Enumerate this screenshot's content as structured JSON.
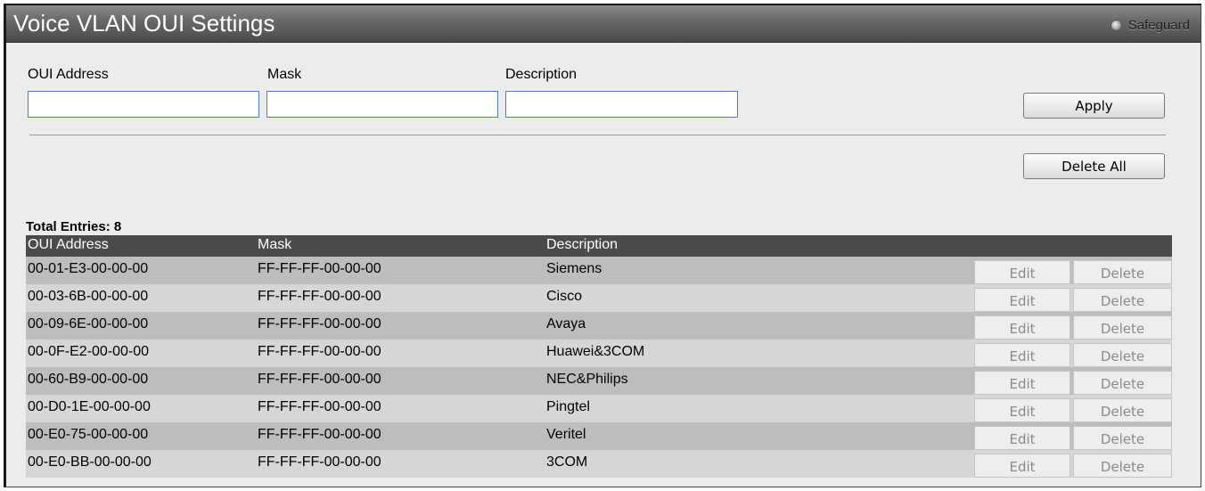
{
  "window": {
    "title": "Voice VLAN OUI Settings",
    "safeguard_label": "Safeguard"
  },
  "form": {
    "oui_label": "OUI Address",
    "mask_label": "Mask",
    "description_label": "Description",
    "oui_value": "",
    "mask_value": "",
    "description_value": "",
    "apply_label": "Apply",
    "delete_all_label": "Delete All"
  },
  "table": {
    "total_entries": "Total Entries: 8",
    "headers": [
      "OUI Address",
      "Mask",
      "Description"
    ],
    "edit_label": "Edit",
    "delete_label": "Delete",
    "rows": [
      {
        "oui": "00-01-E3-00-00-00",
        "mask": "FF-FF-FF-00-00-00",
        "description": "Siemens"
      },
      {
        "oui": "00-03-6B-00-00-00",
        "mask": "FF-FF-FF-00-00-00",
        "description": "Cisco"
      },
      {
        "oui": "00-09-6E-00-00-00",
        "mask": "FF-FF-FF-00-00-00",
        "description": "Avaya"
      },
      {
        "oui": "00-0F-E2-00-00-00",
        "mask": "FF-FF-FF-00-00-00",
        "description": "Huawei&3COM"
      },
      {
        "oui": "00-60-B9-00-00-00",
        "mask": "FF-FF-FF-00-00-00",
        "description": "NEC&Philips"
      },
      {
        "oui": "00-D0-1E-00-00-00",
        "mask": "FF-FF-FF-00-00-00",
        "description": "Pingtel"
      },
      {
        "oui": "00-E0-75-00-00-00",
        "mask": "FF-FF-FF-00-00-00",
        "description": "Veritel"
      },
      {
        "oui": "00-E0-BB-00-00-00",
        "mask": "FF-FF-FF-00-00-00",
        "description": "3COM"
      }
    ]
  },
  "colors": {
    "title_bar": "#5a5a5a",
    "table_header": "#4b4b4b",
    "row_odd": "#bdbdbd",
    "row_even": "#d6d6d6",
    "input_border": "#4a7fc0"
  }
}
